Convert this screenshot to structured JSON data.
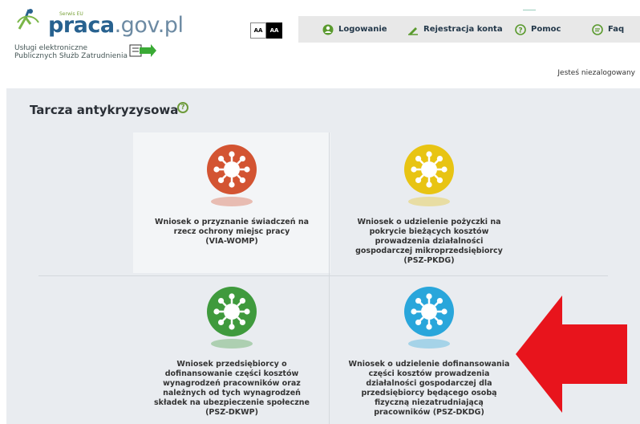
{
  "header": {
    "logo_main": "praca",
    "logo_suffix": ".gov.pl",
    "logo_tag": "Serwis EU",
    "services_line1": "Usługi elektroniczne",
    "services_line2": "Publicznych Służb Zatrudnienia",
    "font_normal": "AA",
    "font_contrast": "AA"
  },
  "nav": {
    "login": "Logowanie",
    "register": "Rejestracja konta",
    "help": "Pomoc",
    "faq": "Faq"
  },
  "status": "Jesteś niezalogowany",
  "section": {
    "title": "Tarcza antykryzysowa",
    "help_glyph": "?"
  },
  "tiles": [
    {
      "lines": [
        "Wniosek o przyznanie świadczeń na",
        "rzecz ochrony miejsc pracy",
        "(VIA-WOMP)"
      ],
      "color": "#d35432",
      "icon": "virus-icon"
    },
    {
      "lines": [
        "Wniosek o udzielenie pożyczki na",
        "pokrycie bieżących kosztów",
        "prowadzenia działalności",
        "gospodarczej mikroprzedsiębiorcy",
        "(PSZ-PKDG)"
      ],
      "color": "#e8c413",
      "icon": "virus-icon"
    },
    {
      "lines": [
        "Wniosek przedsiębiorcy o",
        "dofinansowanie części kosztów",
        "wynagrodzeń pracowników oraz",
        "należnych od tych wynagrodzeń",
        "składek na ubezpieczenie społeczne",
        "(PSZ-DKWP)"
      ],
      "color": "#3f9a3d",
      "icon": "virus-icon"
    },
    {
      "lines": [
        "Wniosek o udzielenie dofinansowania",
        "części kosztów prowadzenia",
        "działalności gospodarczej dla",
        "przedsiębiorcy będącego osobą",
        "fizyczną niezatrudniającą",
        "pracowników (PSZ-DKDG)"
      ],
      "color": "#29a6db",
      "icon": "virus-icon"
    }
  ],
  "colors": {
    "brand": "#27618f",
    "accent": "#6d9a3a",
    "arrow": "#e8141c"
  }
}
